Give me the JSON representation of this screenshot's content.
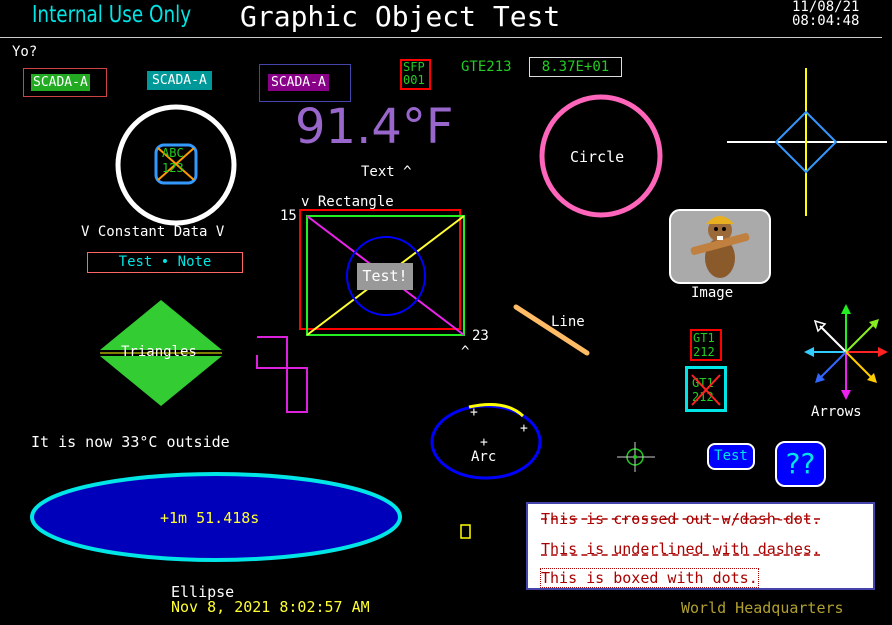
{
  "header": {
    "internal_label": "Internal Use Only",
    "title": "Graphic Object Test",
    "date": "11/08/21",
    "time": "08:04:48"
  },
  "yo_label": "Yo?",
  "scada_buttons": [
    "SCADA-A",
    "SCADA-A",
    "SCADA-A"
  ],
  "sfp": {
    "line1": "SFP",
    "line2": "001"
  },
  "gte_label": "GTE213",
  "gte_value": "8.37E+01",
  "temperature": "91.4°F",
  "text_label": "Text ^",
  "circle_label": "Circle",
  "badge_text": {
    "line1": "ABC",
    "line2": "123"
  },
  "constant_data_label": "V Constant Data V",
  "note_button": "Test • Note",
  "rectangle": {
    "top_label": "v  Rectangle",
    "left_value": "15",
    "right_value": "23",
    "bottom_caret": "^",
    "button": "Test!"
  },
  "image_label": "Image",
  "line_label": "Line",
  "triangles_label": "Triangles",
  "gt_box_top": {
    "line1": "GT1",
    "line2": "212"
  },
  "gt_box_bottom": {
    "line1": "GT1",
    "line2": "212"
  },
  "arrows_label": "Arrows",
  "outside_text": "It is now 33°C outside",
  "arc_label": "Arc",
  "test_button": "Test",
  "help_button": "??",
  "ellipse_value": "+1m 51.418s",
  "ellipse_label": "Ellipse",
  "datetime_text": "Nov 8, 2021  8:02:57 AM",
  "notes": {
    "crossed": "This is crossed out w/dash-dot.",
    "underlined": "This is underlined with dashes.",
    "boxed": "This is boxed with dots."
  },
  "footer": "World Headquarters",
  "colors": {
    "accent_cyan": "#00e5e5",
    "green": "#22cc22",
    "teal": "#009999",
    "purple": "#880088",
    "temp_purple": "#9966cc",
    "pink": "#ff66bb",
    "yellow": "#ffff00",
    "red": "#ff0000",
    "blue": "#0000ff",
    "olive": "#b0a030"
  },
  "icons": [
    "beaver-mascot-image",
    "crosshair-icon",
    "diamond-cross-icon",
    "compass-arrows-icon"
  ]
}
